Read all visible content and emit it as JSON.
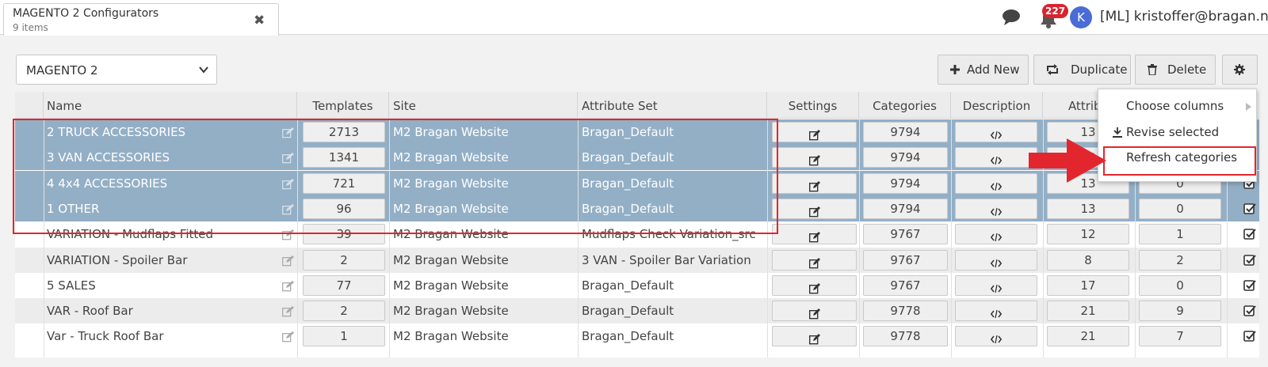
{
  "tab": {
    "title": "MAGENTO 2 Configurators",
    "subtitle": "9 items",
    "close": "✖"
  },
  "header": {
    "notifications": "227",
    "avatar_letter": "K",
    "user": "[ML] kristoffer@bragan.net"
  },
  "toolbar": {
    "channel": "MAGENTO 2",
    "add_new": "Add New",
    "duplicate": "Duplicate",
    "delete": "Delete"
  },
  "columns": {
    "name": "Name",
    "templates": "Templates",
    "site": "Site",
    "attribute_set": "Attribute Set",
    "settings": "Settings",
    "categories": "Categories",
    "description": "Description",
    "attributes": "Attribu"
  },
  "rows": [
    {
      "name": "2 TRUCK ACCESSORIES",
      "templates": "2713",
      "site": "M2 Bragan Website",
      "attribute_set": "Bragan_Default",
      "categories": "9794",
      "attributes": "13",
      "extra": "",
      "selected": true
    },
    {
      "name": "3 VAN ACCESSORIES",
      "templates": "1341",
      "site": "M2 Bragan Website",
      "attribute_set": "Bragan_Default",
      "categories": "9794",
      "attributes": "13",
      "extra": "",
      "selected": true
    },
    {
      "name": "4 4x4 ACCESSORIES",
      "templates": "721",
      "site": "M2 Bragan Website",
      "attribute_set": "Bragan_Default",
      "categories": "9794",
      "attributes": "13",
      "extra": "0",
      "selected": true
    },
    {
      "name": "1 OTHER",
      "templates": "96",
      "site": "M2 Bragan Website",
      "attribute_set": "Bragan_Default",
      "categories": "9794",
      "attributes": "13",
      "extra": "0",
      "selected": true
    },
    {
      "name": "VARIATION - Mudflaps Fitted",
      "templates": "39",
      "site": "M2 Bragan Website",
      "attribute_set": "Mudflaps Check Variation_src",
      "categories": "9767",
      "attributes": "12",
      "extra": "1",
      "selected": false
    },
    {
      "name": "VARIATION - Spoiler Bar",
      "templates": "2",
      "site": "M2 Bragan Website",
      "attribute_set": "3 VAN - Spoiler Bar Variation",
      "categories": "9767",
      "attributes": "8",
      "extra": "2",
      "selected": false
    },
    {
      "name": "5 SALES",
      "templates": "77",
      "site": "M2 Bragan Website",
      "attribute_set": "Bragan_Default",
      "categories": "9767",
      "attributes": "17",
      "extra": "0",
      "selected": false
    },
    {
      "name": "VAR - Roof Bar",
      "templates": "2",
      "site": "M2 Bragan Website",
      "attribute_set": "Bragan_Default",
      "categories": "9778",
      "attributes": "21",
      "extra": "9",
      "selected": false
    },
    {
      "name": "Var - Truck Roof Bar",
      "templates": "1",
      "site": "M2 Bragan Website",
      "attribute_set": "Bragan_Default",
      "categories": "9778",
      "attributes": "21",
      "extra": "7",
      "selected": false
    }
  ],
  "menu": {
    "choose_columns": "Choose columns",
    "revise_selected": "Revise selected",
    "refresh_categories": "Refresh categories"
  },
  "colors": {
    "selected_row": "#93afc6",
    "annotation_red": "#e3262d",
    "badge_red": "#d9232e",
    "avatar_blue": "#4a6cd6"
  },
  "icons": [
    "close-icon",
    "chat-icon",
    "bell-icon",
    "chevron-down-icon",
    "plus-icon",
    "duplicate-icon",
    "trash-icon",
    "gear-icon",
    "edit-icon",
    "code-icon",
    "checkbox-icon",
    "chevron-right-icon",
    "revise-icon"
  ]
}
